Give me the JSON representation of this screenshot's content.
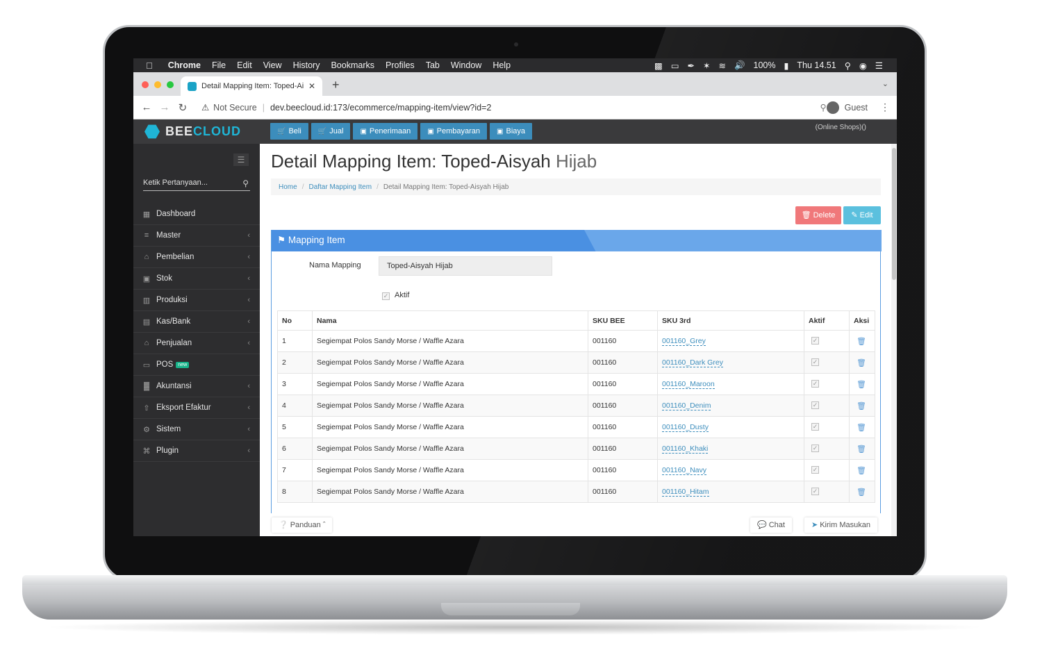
{
  "menubar": {
    "app": "Chrome",
    "items": [
      "File",
      "Edit",
      "View",
      "History",
      "Bookmarks",
      "Profiles",
      "Tab",
      "Window",
      "Help"
    ],
    "battery": "100%",
    "clock": "Thu 14.51"
  },
  "browser": {
    "tab_title": "Detail Mapping Item: Toped-Ai",
    "not_secure": "Not Secure",
    "url": "dev.beecloud.id:173/ecommerce/mapping-item/view?id=2",
    "profile": "Guest"
  },
  "app": {
    "brand_a": "BEE",
    "brand_b": "CLOUD",
    "top_buttons": [
      "Beli",
      "Jual",
      "Penerimaan",
      "Pembayaran",
      "Biaya"
    ],
    "shops": "(Online Shops)()"
  },
  "sidebar": {
    "search_placeholder": "Ketik Pertanyaan...",
    "items": [
      {
        "label": "Dashboard",
        "icon": "dashboard-icon",
        "has_chevron": false
      },
      {
        "label": "Master",
        "icon": "database-icon",
        "has_chevron": true
      },
      {
        "label": "Pembelian",
        "icon": "cart-icon",
        "has_chevron": true
      },
      {
        "label": "Stok",
        "icon": "box-icon",
        "has_chevron": true
      },
      {
        "label": "Produksi",
        "icon": "factory-icon",
        "has_chevron": true
      },
      {
        "label": "Kas/Bank",
        "icon": "money-icon",
        "has_chevron": true
      },
      {
        "label": "Penjualan",
        "icon": "cart-icon",
        "has_chevron": true
      },
      {
        "label": "POS",
        "icon": "monitor-icon",
        "has_chevron": false,
        "badge": "new"
      },
      {
        "label": "Akuntansi",
        "icon": "chart-icon",
        "has_chevron": true
      },
      {
        "label": "Eksport Efaktur",
        "icon": "export-icon",
        "has_chevron": true
      },
      {
        "label": "Sistem",
        "icon": "gears-icon",
        "has_chevron": true
      },
      {
        "label": "Plugin",
        "icon": "plug-icon",
        "has_chevron": true
      }
    ]
  },
  "page": {
    "title_main": "Detail Mapping Item: Toped-Aisyah",
    "title_light": "Hijab",
    "breadcrumb": [
      "Home",
      "Daftar Mapping Item",
      "Detail Mapping Item: Toped-Aisyah Hijab"
    ],
    "delete_label": "Delete",
    "edit_label": "Edit"
  },
  "panel": {
    "title": "Mapping Item",
    "nama_label": "Nama Mapping",
    "nama_value": "Toped-Aisyah Hijab",
    "aktif_label": "Aktif",
    "aktif_checked": true
  },
  "table": {
    "headers": [
      "No",
      "Nama",
      "SKU BEE",
      "SKU 3rd",
      "Aktif",
      "Aksi"
    ],
    "rows": [
      {
        "no": "1",
        "nama": "Segiempat Polos Sandy Morse / Waffle Azara",
        "sku_bee": "001160",
        "sku_3rd": "001160_Grey"
      },
      {
        "no": "2",
        "nama": "Segiempat Polos Sandy Morse / Waffle Azara",
        "sku_bee": "001160",
        "sku_3rd": "001160_Dark Grey"
      },
      {
        "no": "3",
        "nama": "Segiempat Polos Sandy Morse / Waffle Azara",
        "sku_bee": "001160",
        "sku_3rd": "001160_Maroon"
      },
      {
        "no": "4",
        "nama": "Segiempat Polos Sandy Morse / Waffle Azara",
        "sku_bee": "001160",
        "sku_3rd": "001160_Denim"
      },
      {
        "no": "5",
        "nama": "Segiempat Polos Sandy Morse / Waffle Azara",
        "sku_bee": "001160",
        "sku_3rd": "001160_Dusty"
      },
      {
        "no": "6",
        "nama": "Segiempat Polos Sandy Morse / Waffle Azara",
        "sku_bee": "001160",
        "sku_3rd": "001160_Khaki"
      },
      {
        "no": "7",
        "nama": "Segiempat Polos Sandy Morse / Waffle Azara",
        "sku_bee": "001160",
        "sku_3rd": "001160_Navy"
      },
      {
        "no": "8",
        "nama": "Segiempat Polos Sandy Morse / Waffle Azara",
        "sku_bee": "001160",
        "sku_3rd": "001160_Hitam"
      }
    ]
  },
  "footer": {
    "panduan": "Panduan",
    "chat": "Chat",
    "kirim": "Kirim Masukan"
  },
  "colors": {
    "primary": "#3c8dbc",
    "panel_header": "#4a90e2",
    "delete": "#f0787a",
    "edit": "#5bc0de",
    "sidebar": "#2d2d2f",
    "brand_accent": "#1fb5d6"
  }
}
